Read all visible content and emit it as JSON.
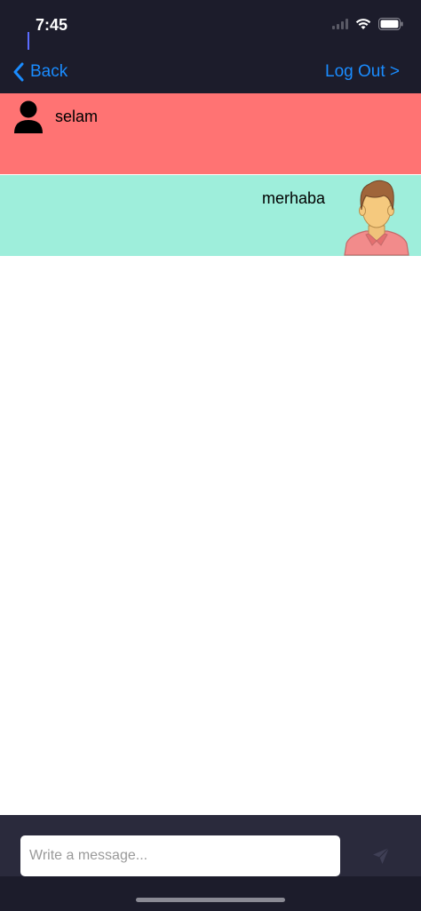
{
  "status_bar": {
    "time": "7:45"
  },
  "nav": {
    "back_label": "Back",
    "logout_label": "Log Out >"
  },
  "messages": [
    {
      "text": "selam",
      "direction": "incoming",
      "background": "#ff7373",
      "avatar": "user-silhouette-icon"
    },
    {
      "text": "merhaba",
      "direction": "outgoing",
      "background": "#9eeedb",
      "avatar": "man-avatar-icon"
    }
  ],
  "composer": {
    "placeholder": "Write a message...",
    "send_icon": "send-icon"
  },
  "colors": {
    "bar_background": "#1c1c2b",
    "accent": "#1a8cff"
  }
}
